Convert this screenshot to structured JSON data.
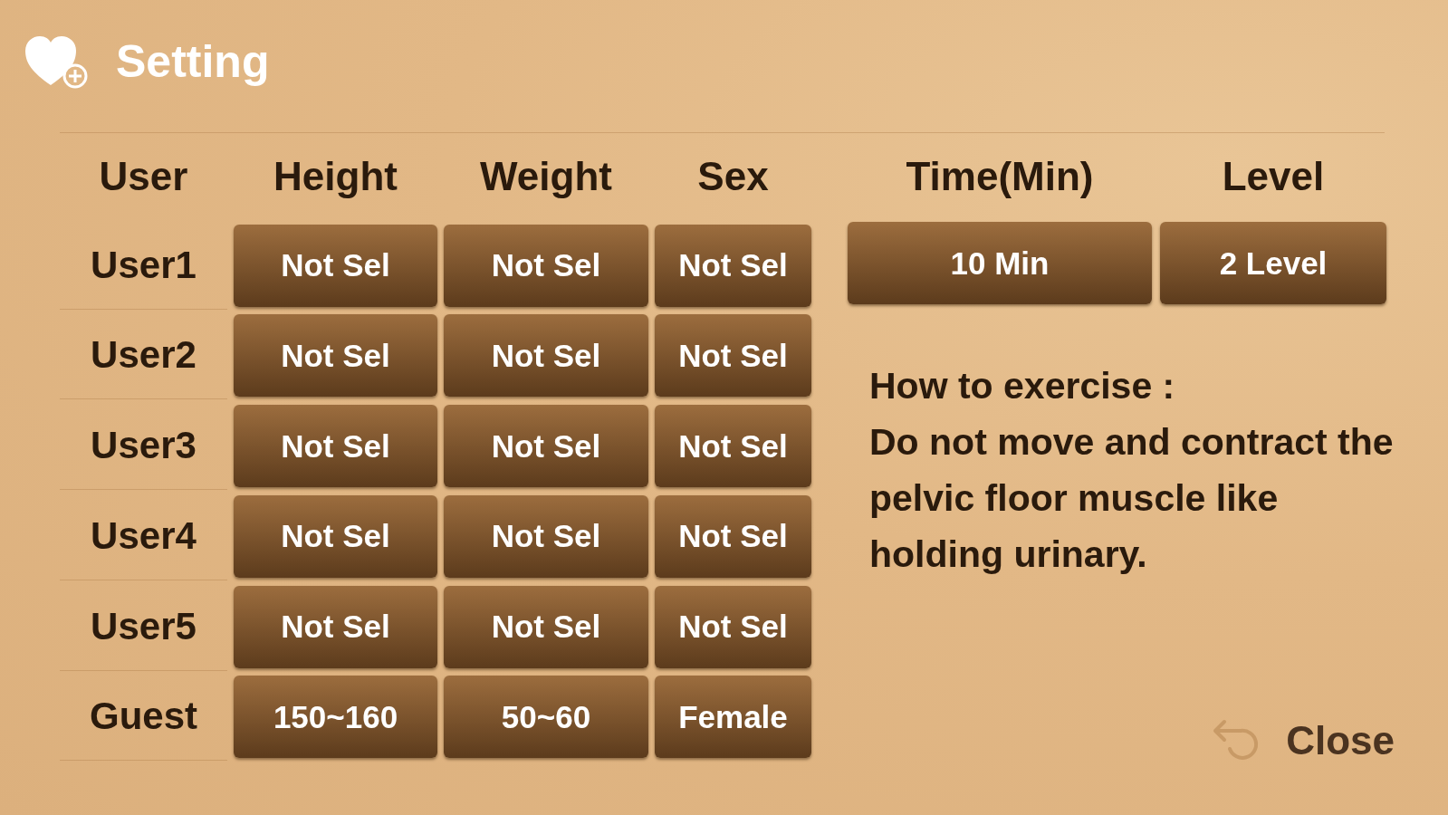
{
  "title": "Setting",
  "table": {
    "columns": [
      "User",
      "Height",
      "Weight",
      "Sex"
    ],
    "rows": [
      {
        "user": "User1",
        "values": [
          "Not Sel",
          "Not Sel",
          "Not Sel"
        ]
      },
      {
        "user": "User2",
        "values": [
          "Not Sel",
          "Not Sel",
          "Not Sel"
        ]
      },
      {
        "user": "User3",
        "values": [
          "Not Sel",
          "Not Sel",
          "Not Sel"
        ]
      },
      {
        "user": "User4",
        "values": [
          "Not Sel",
          "Not Sel",
          "Not Sel"
        ]
      },
      {
        "user": "User5",
        "values": [
          "Not Sel",
          "Not Sel",
          "Not Sel"
        ]
      },
      {
        "user": "Guest",
        "values": [
          "150~160",
          "50~60",
          "Female"
        ]
      }
    ]
  },
  "exercise": {
    "columns": [
      "Time(Min)",
      "Level"
    ],
    "values": [
      "10 Min",
      "2 Level"
    ]
  },
  "instructions": {
    "heading": "How to exercise :",
    "body": "Do not move and contract the pelvic floor muscle like holding urinary."
  },
  "close_button": "Close"
}
